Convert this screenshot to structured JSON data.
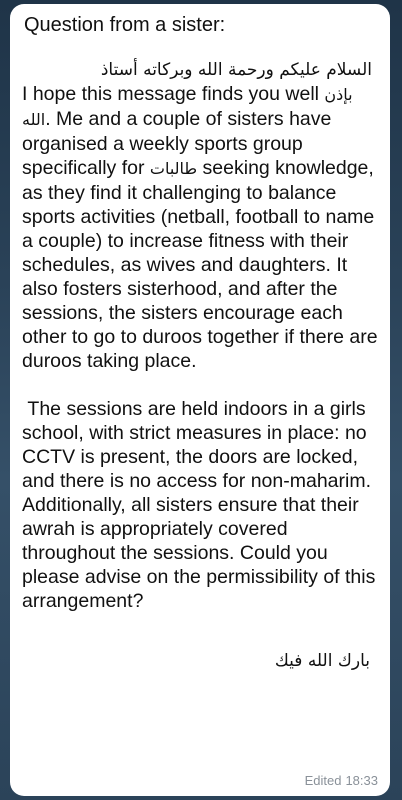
{
  "message": {
    "header": "Question from a sister:",
    "greeting": "السلام عليكم ورحمة الله وبركاته أستاذ",
    "p1": {
      "s1": "I hope this message finds you well ",
      "ar1": "بإذن الله",
      "s2": ". Me and a couple of sisters have organised a weekly sports group specifically for ",
      "ar2": "طالبات",
      "s3": " seeking knowledge, as they find it challenging to balance sports activities (netball, football to name a couple) to increase fitness with their schedules, as wives and daughters. It also fosters sisterhood, and after the sessions, the sisters encourage each other to go to duroos together if there are duroos taking place."
    },
    "p2": " The sessions are held indoors in a girls school, with strict measures in place: no CCTV is present, the doors are locked, and there is no access for non-maharim. Additionally, all sisters ensure that their awrah is appropriately covered throughout the sessions. Could you please advise on the permissibility of this arrangement?",
    "closing": "بارك الله فيك",
    "edited_label": "Edited",
    "time": "18:33"
  }
}
